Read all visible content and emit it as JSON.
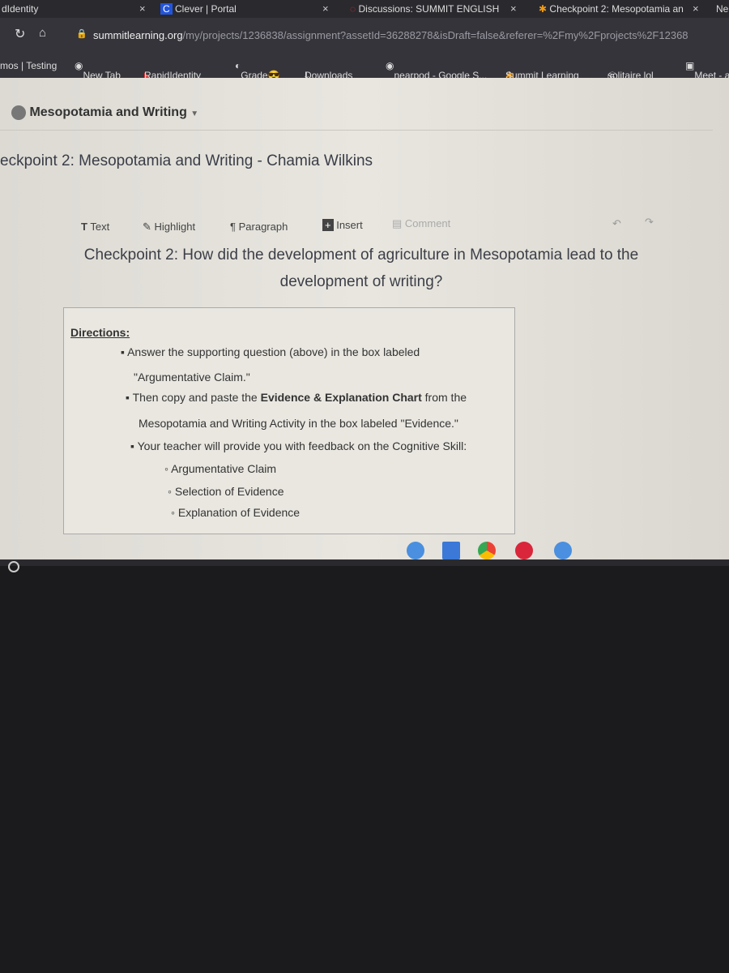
{
  "tabs": [
    {
      "label": "dIdentity"
    },
    {
      "label": "Clever | Portal"
    },
    {
      "label": "Discussions: SUMMIT ENGLISH"
    },
    {
      "label": "Checkpoint 2: Mesopotamia an"
    },
    {
      "label": "Ne"
    }
  ],
  "address": {
    "domain": "summitlearning.org",
    "path": "/my/projects/1236838/assignment?assetId=36288278&isDraft=false&referer=%2Fmy%2Fprojects%2F12368"
  },
  "bookmarks": [
    "mos | Testing",
    "New Tab",
    "RapidIdentity",
    "Grade😎",
    "Downloads",
    "nearpod - Google S...",
    "Summit Learning",
    "solitaire lol",
    "Meet - a"
  ],
  "project": {
    "name": "Mesopotamia and Writing"
  },
  "assignment_title": "eckpoint 2: Mesopotamia and Writing - Chamia Wilkins",
  "toolbar": {
    "text": "Text",
    "highlight": "Highlight",
    "paragraph": "Paragraph",
    "insert": "Insert",
    "comment": "Comment"
  },
  "question": "Checkpoint 2: How did the development of agriculture in Mesopotamia lead to the development of writing?",
  "directions": {
    "heading": "Directions:",
    "b1a": "Answer the supporting question (above) in the box labeled",
    "b1b": "\"Argumentative Claim.\"",
    "b2a": "Then copy and paste the ",
    "b2bold": "Evidence & Explanation Chart",
    "b2c": " from the",
    "b2d": "Mesopotamia and Writing Activity in the box labeled \"Evidence.\"",
    "b3": "Your teacher will provide you with feedback on the Cognitive Skill:",
    "skills": [
      "Argumentative Claim",
      "Selection of Evidence",
      "Explanation of Evidence"
    ]
  },
  "colors": {
    "chrome": "#35343a",
    "accent": "#f39c12"
  }
}
